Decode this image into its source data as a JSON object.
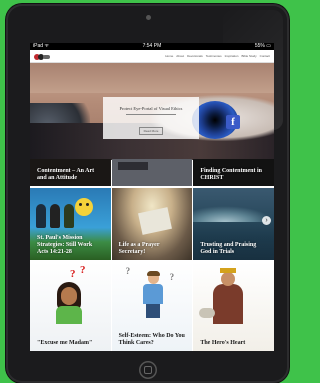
{
  "status_bar": {
    "left": "iPad ᯤ",
    "center": "7:54 PM",
    "right": "55% ▭"
  },
  "nav": {
    "links": [
      "Home",
      "About",
      "Devotionals",
      "Testimonies",
      "Inspiration",
      "Bible Study",
      "Contact"
    ]
  },
  "hero": {
    "title": "Protect Eye-Portal of Visual Ethics",
    "button": "Read More"
  },
  "tiles": {
    "contentment": {
      "caption": "Contentment – An Art and an Attitude"
    },
    "finding": {
      "caption": "Finding Contentment in CHRIST"
    },
    "paul": {
      "caption": "St. Paul's Mission Strategies: Still Work Acts 14:21-28"
    },
    "life": {
      "caption": "Life as a Prayer Secretary!"
    },
    "trials": {
      "caption": "Trusting and Praising God in Trials"
    },
    "modest": {
      "caption": "\"Excuse me Madam\""
    },
    "self": {
      "caption": "Self-Esteem: Who Do You Think Cares?"
    },
    "heart": {
      "caption": "The Hero's Heart"
    }
  },
  "colors": {
    "background": "#3fc24a",
    "device": "#1b1b1d",
    "iris": "#2a5bc4"
  }
}
